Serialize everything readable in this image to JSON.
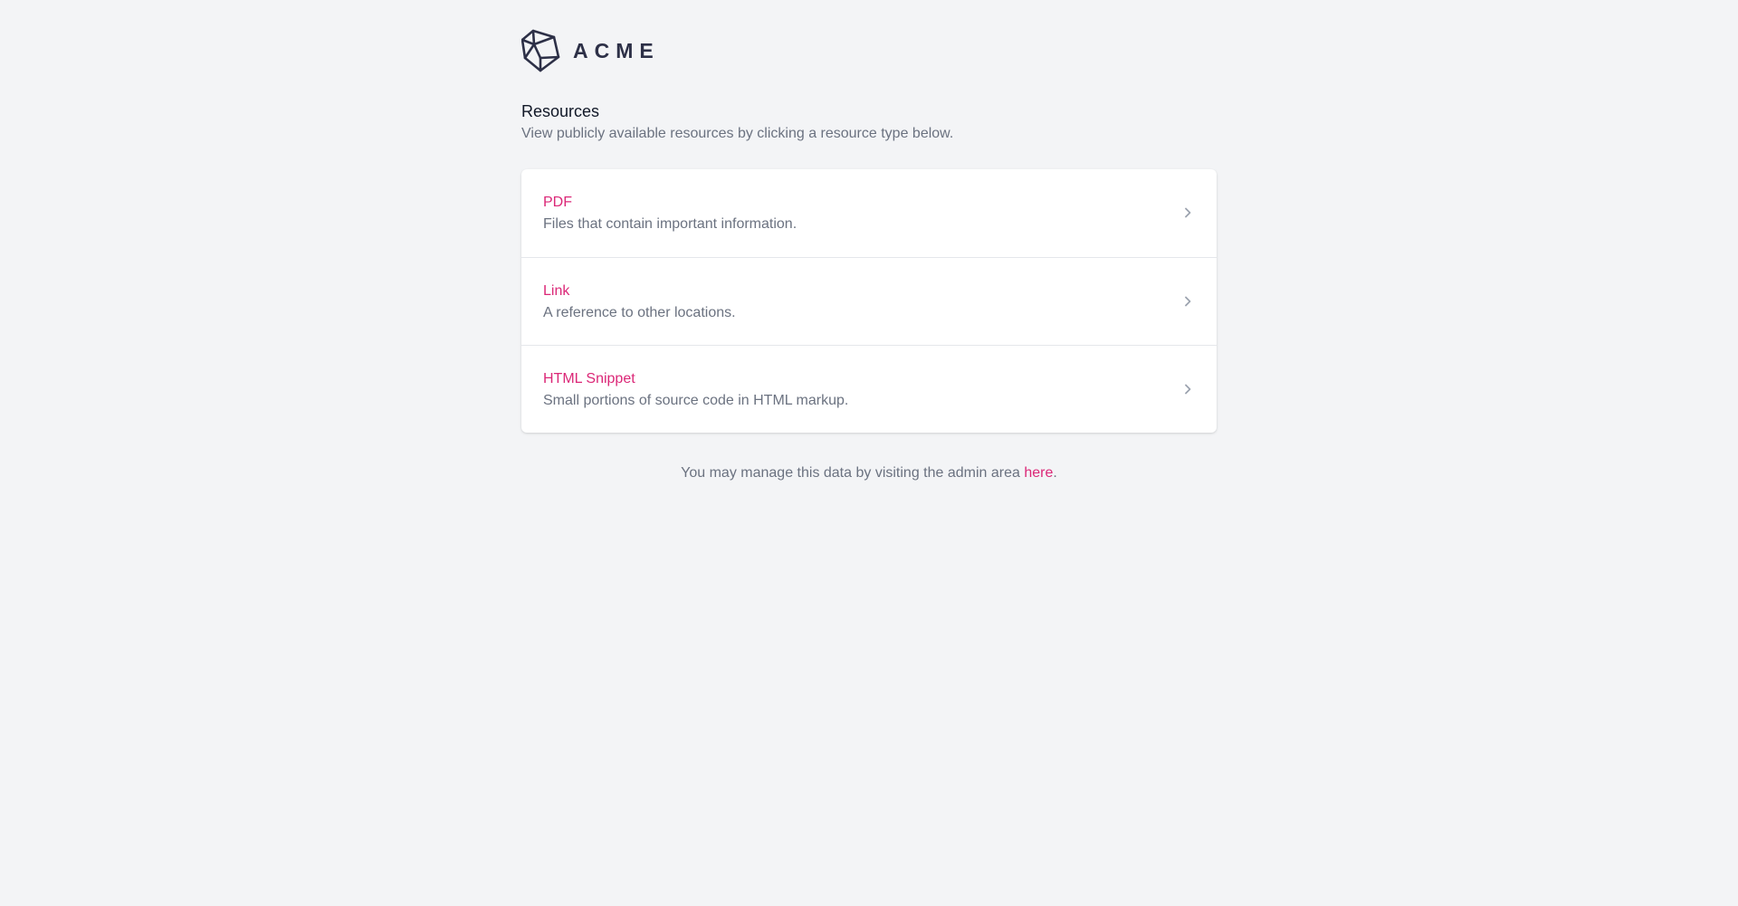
{
  "brand": {
    "wordmark": "ACME",
    "logo_icon": "cube-wireframe-icon"
  },
  "header": {
    "title": "Resources",
    "subtitle": "View publicly available resources by clicking a resource type below."
  },
  "resources": [
    {
      "title": "PDF",
      "description": "Files that contain important information.",
      "icon": "chevron-right-icon"
    },
    {
      "title": "Link",
      "description": "A reference to other locations.",
      "icon": "chevron-right-icon"
    },
    {
      "title": "HTML Snippet",
      "description": "Small portions of source code in HTML markup.",
      "icon": "chevron-right-icon"
    }
  ],
  "footer": {
    "text_before": "You may manage this data by visiting the admin area ",
    "link_text": "here",
    "text_after": "."
  },
  "colors": {
    "background": "#f3f4f6",
    "accent": "#db2777",
    "muted_text": "#6b7280",
    "brand_dark": "#2d3047"
  }
}
